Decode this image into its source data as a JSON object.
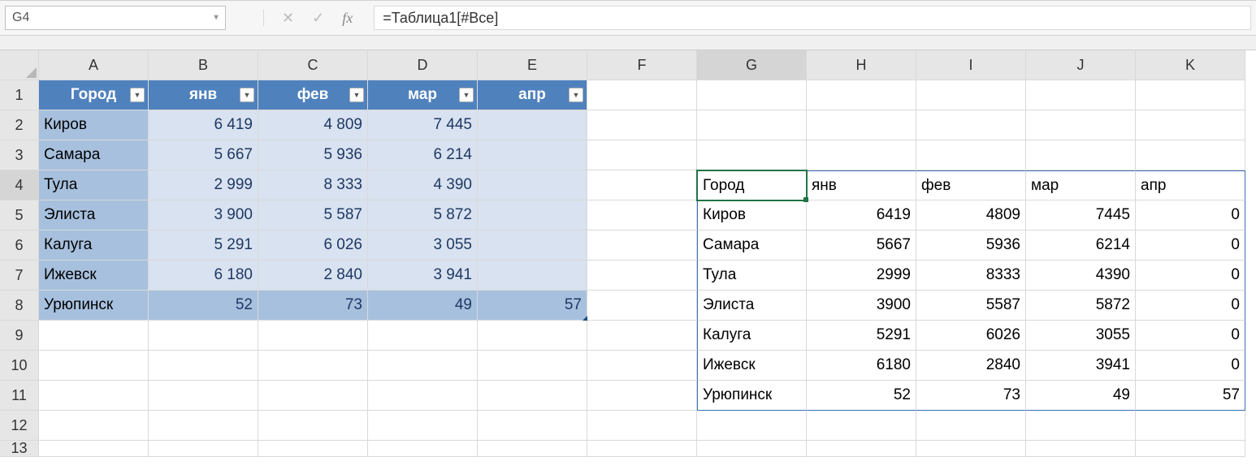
{
  "formula_bar": {
    "cell_ref": "G4",
    "formula": "=Таблица1[#Все]",
    "cancel_label": "✕",
    "accept_label": "✓",
    "fx_label": "fx"
  },
  "col_headers": [
    "A",
    "B",
    "C",
    "D",
    "E",
    "F",
    "G",
    "H",
    "I",
    "J",
    "K"
  ],
  "row_headers": [
    1,
    2,
    3,
    4,
    5,
    6,
    7,
    8,
    9,
    10,
    11,
    12,
    13
  ],
  "table1": {
    "headers": [
      "Город",
      "янв",
      "фев",
      "мар",
      "апр"
    ],
    "rows": [
      {
        "city": "Киров",
        "jan": "6 419",
        "feb": "4 809",
        "mar": "7 445",
        "apr": ""
      },
      {
        "city": "Самара",
        "jan": "5 667",
        "feb": "5 936",
        "mar": "6 214",
        "apr": ""
      },
      {
        "city": "Тула",
        "jan": "2 999",
        "feb": "8 333",
        "mar": "4 390",
        "apr": ""
      },
      {
        "city": "Элиста",
        "jan": "3 900",
        "feb": "5 587",
        "mar": "5 872",
        "apr": ""
      },
      {
        "city": "Калуга",
        "jan": "5 291",
        "feb": "6 026",
        "mar": "3 055",
        "apr": ""
      },
      {
        "city": "Ижевск",
        "jan": "6 180",
        "feb": "2 840",
        "mar": "3 941",
        "apr": ""
      },
      {
        "city": "Урюпинск",
        "jan": "52",
        "feb": "73",
        "mar": "49",
        "apr": "57"
      }
    ]
  },
  "spill": {
    "headers": [
      "Город",
      "янв",
      "фев",
      "мар",
      "апр"
    ],
    "rows": [
      {
        "city": "Киров",
        "jan": "6419",
        "feb": "4809",
        "mar": "7445",
        "apr": "0"
      },
      {
        "city": "Самара",
        "jan": "5667",
        "feb": "5936",
        "mar": "6214",
        "apr": "0"
      },
      {
        "city": "Тула",
        "jan": "2999",
        "feb": "8333",
        "mar": "4390",
        "apr": "0"
      },
      {
        "city": "Элиста",
        "jan": "3900",
        "feb": "5587",
        "mar": "5872",
        "apr": "0"
      },
      {
        "city": "Калуга",
        "jan": "5291",
        "feb": "6026",
        "mar": "3055",
        "apr": "0"
      },
      {
        "city": "Ижевск",
        "jan": "6180",
        "feb": "2840",
        "mar": "3941",
        "apr": "0"
      },
      {
        "city": "Урюпинск",
        "jan": "52",
        "feb": "73",
        "mar": "49",
        "apr": "57"
      }
    ]
  }
}
